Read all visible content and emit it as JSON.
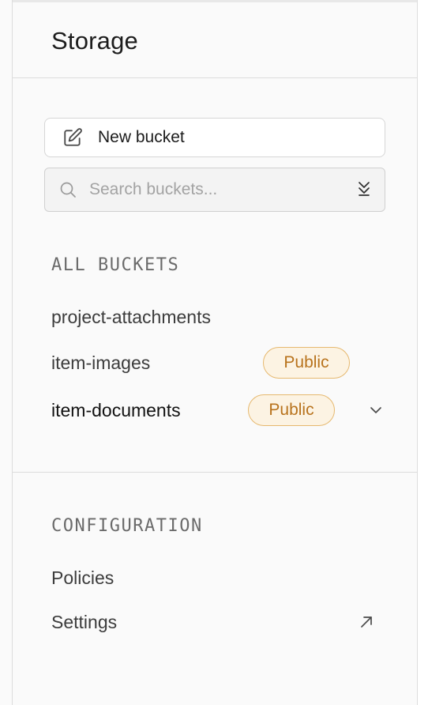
{
  "header": {
    "title": "Storage"
  },
  "actions": {
    "new_bucket_label": "New bucket",
    "new_bucket_icon": "edit-icon"
  },
  "search": {
    "placeholder": "Search buckets...",
    "value": "",
    "icon": "search-icon",
    "sort_icon": "chevrons-up-down-icon"
  },
  "buckets": {
    "heading": "ALL BUCKETS",
    "items": [
      {
        "name": "project-attachments",
        "badge": ""
      },
      {
        "name": "item-images",
        "badge": "Public"
      },
      {
        "name": "item-documents",
        "badge": "Public",
        "active": true
      }
    ]
  },
  "configuration": {
    "heading": "CONFIGURATION",
    "items": [
      {
        "name": "Policies"
      },
      {
        "name": "Settings",
        "icon": "external-link-icon"
      }
    ]
  },
  "colors": {
    "badge_text": "#b8731d",
    "badge_bg": "#fcf3e3",
    "badge_border": "#e6b86e",
    "background": "#fafafa"
  }
}
